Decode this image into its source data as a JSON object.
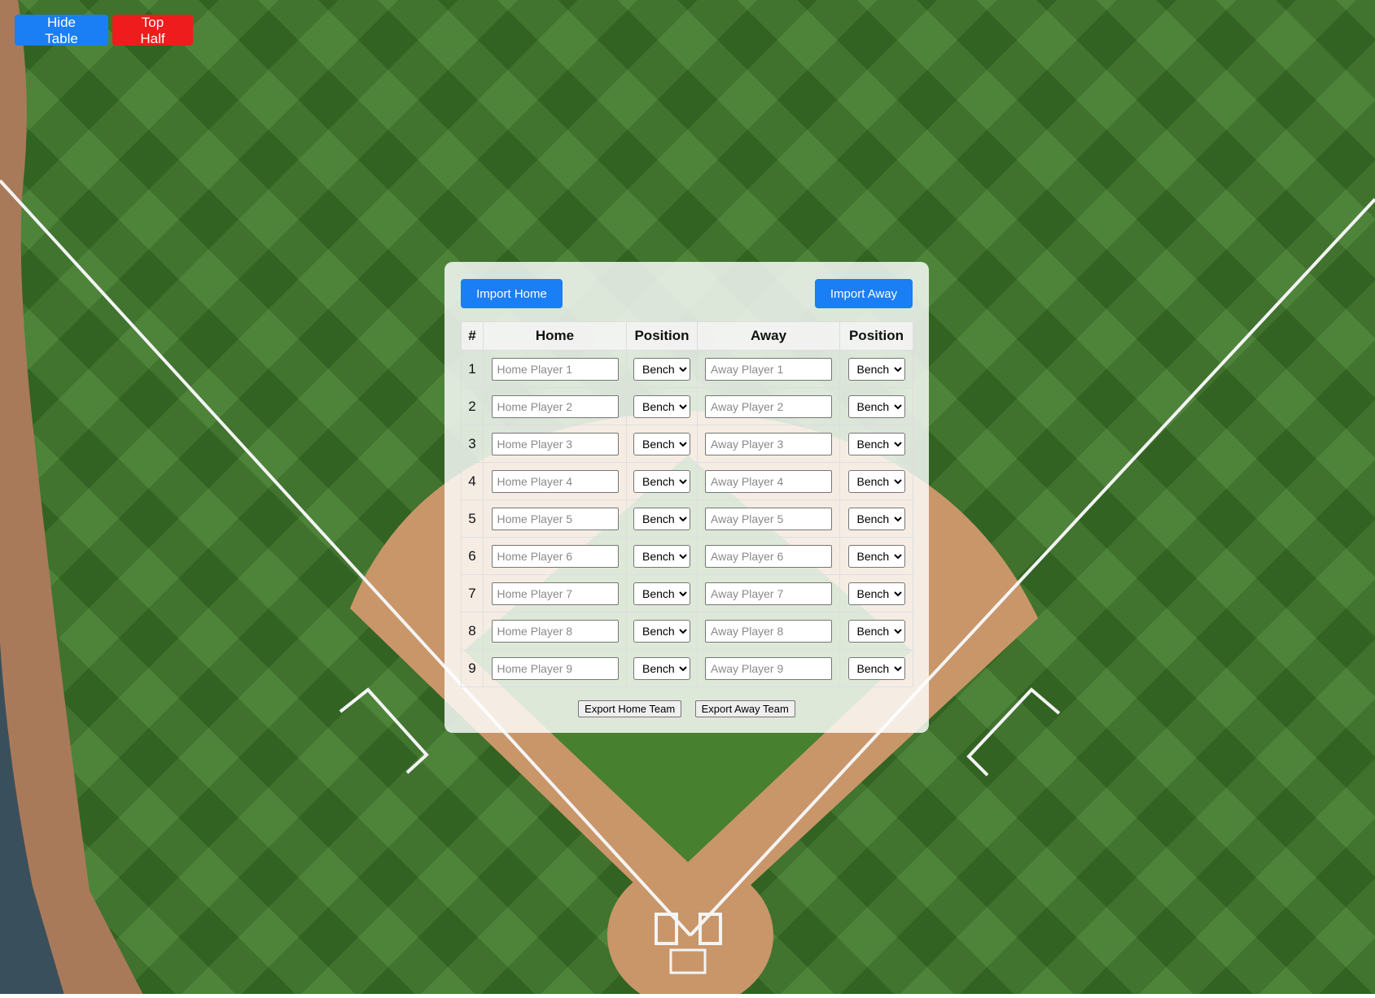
{
  "toolbar": {
    "hide_table_label": "Hide Table",
    "top_half_label": "Top Half"
  },
  "panel": {
    "import_home_label": "Import Home",
    "import_away_label": "Import Away",
    "export_home_label": "Export Home Team",
    "export_away_label": "Export Away Team"
  },
  "table": {
    "headers": [
      "#",
      "Home",
      "Position",
      "Away",
      "Position"
    ],
    "rows": [
      {
        "num": "1",
        "home_placeholder": "Home Player 1",
        "home_pos": "Bench",
        "away_placeholder": "Away Player 1",
        "away_pos": "Bench"
      },
      {
        "num": "2",
        "home_placeholder": "Home Player 2",
        "home_pos": "Bench",
        "away_placeholder": "Away Player 2",
        "away_pos": "Bench"
      },
      {
        "num": "3",
        "home_placeholder": "Home Player 3",
        "home_pos": "Bench",
        "away_placeholder": "Away Player 3",
        "away_pos": "Bench"
      },
      {
        "num": "4",
        "home_placeholder": "Home Player 4",
        "home_pos": "Bench",
        "away_placeholder": "Away Player 4",
        "away_pos": "Bench"
      },
      {
        "num": "5",
        "home_placeholder": "Home Player 5",
        "home_pos": "Bench",
        "away_placeholder": "Away Player 5",
        "away_pos": "Bench"
      },
      {
        "num": "6",
        "home_placeholder": "Home Player 6",
        "home_pos": "Bench",
        "away_placeholder": "Away Player 6",
        "away_pos": "Bench"
      },
      {
        "num": "7",
        "home_placeholder": "Home Player 7",
        "home_pos": "Bench",
        "away_placeholder": "Away Player 7",
        "away_pos": "Bench"
      },
      {
        "num": "8",
        "home_placeholder": "Home Player 8",
        "home_pos": "Bench",
        "away_placeholder": "Away Player 8",
        "away_pos": "Bench"
      },
      {
        "num": "9",
        "home_placeholder": "Home Player 9",
        "home_pos": "Bench",
        "away_placeholder": "Away Player 9",
        "away_pos": "Bench"
      }
    ]
  },
  "colors": {
    "primary_button": "#1a7ef5",
    "danger_button": "#ee1c1c",
    "grass": "#3f7a2a",
    "dirt": "#c9966a"
  }
}
